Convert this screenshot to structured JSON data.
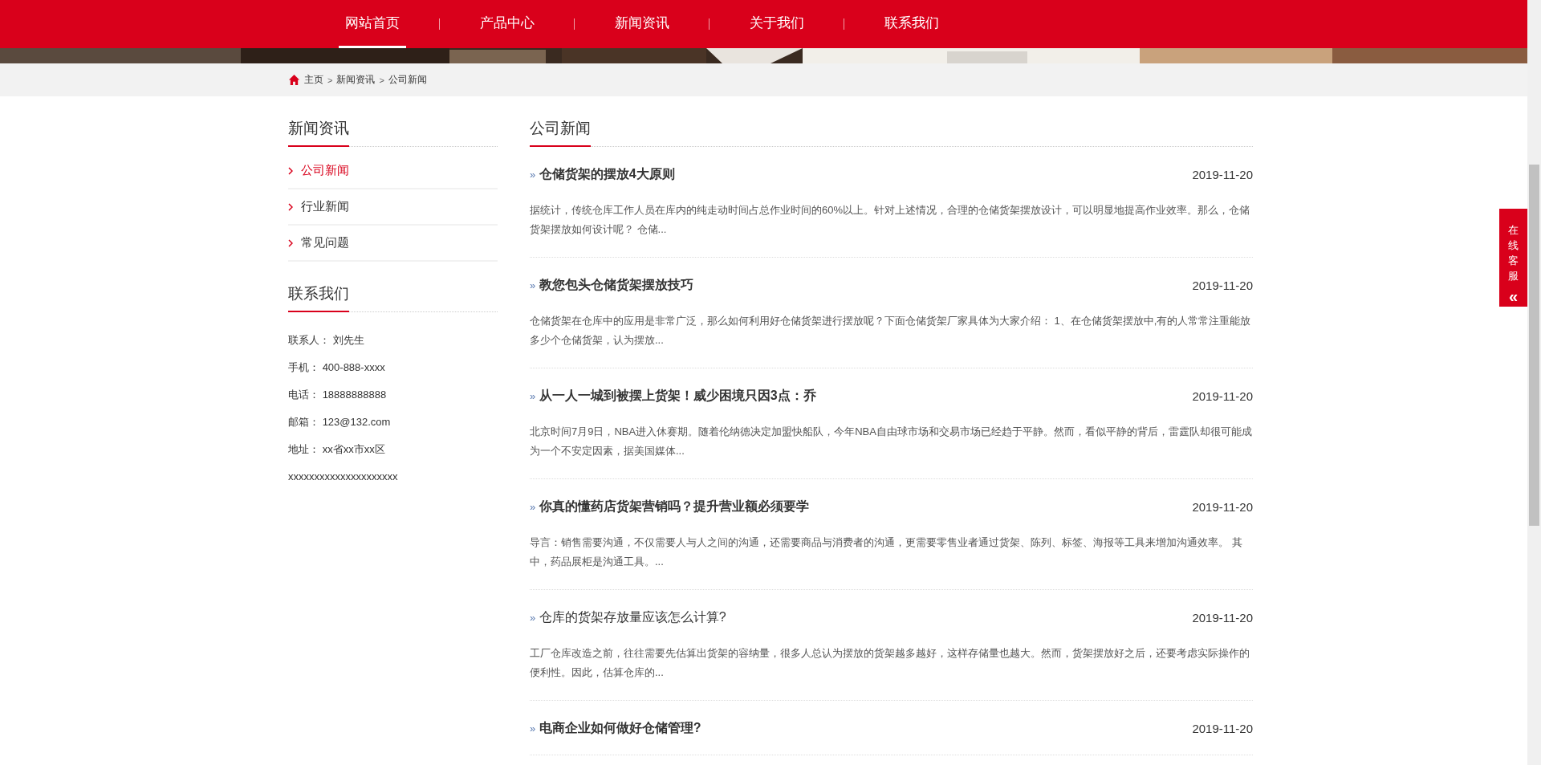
{
  "nav": {
    "items": [
      {
        "label": "网站首页",
        "selected": true
      },
      {
        "label": "产品中心",
        "selected": false
      },
      {
        "label": "新闻资讯",
        "selected": false
      },
      {
        "label": "关于我们",
        "selected": false
      },
      {
        "label": "联系我们",
        "selected": false
      }
    ]
  },
  "breadcrumb": {
    "items": [
      "主页",
      "新闻资讯",
      "公司新闻"
    ],
    "separator": ">"
  },
  "sidebar": {
    "category_title": "新闻资讯",
    "categories": [
      {
        "label": "公司新闻",
        "selected": true
      },
      {
        "label": "行业新闻",
        "selected": false
      },
      {
        "label": "常见问题",
        "selected": false
      }
    ],
    "contact_title": "联系我们",
    "contact_lines": [
      {
        "label": "联系人：",
        "value": "刘先生"
      },
      {
        "label": "手机：",
        "value": "400-888-xxxx"
      },
      {
        "label": "电话：",
        "value": "18888888888"
      },
      {
        "label": "邮箱：",
        "value": "123@132.com"
      },
      {
        "label": "地址：",
        "value": "xx省xx市xx区"
      },
      {
        "value": "xxxxxxxxxxxxxxxxxxxxx"
      }
    ]
  },
  "main": {
    "title": "公司新闻",
    "bullet": "»",
    "articles": [
      {
        "title": "仓储货架的摆放4大原则",
        "bold": true,
        "date": "2019-11-20",
        "summary": "据统计，传统仓库工作人员在库内的纯走动时间占总作业时间的60%以上。针对上述情况，合理的仓储货架摆放设计，可以明显地提高作业效率。那么，仓储货架摆放如何设计呢？ 仓储..."
      },
      {
        "title": "教您包头仓储货架摆放技巧",
        "bold": true,
        "date": "2019-11-20",
        "summary": "仓储货架在仓库中的应用是非常广泛，那么如何利用好仓储货架进行摆放呢？下面仓储货架厂家具体为大家介绍： 1、在仓储货架摆放中,有的人常常注重能放多少个仓储货架，认为摆放..."
      },
      {
        "title": "从一人一城到被摆上货架！威少困境只因3点：乔",
        "bold": true,
        "date": "2019-11-20",
        "summary": "北京时间7月9日，NBA进入休赛期。随着伦纳德决定加盟快船队，今年NBA自由球市场和交易市场已经趋于平静。然而，看似平静的背后，雷霆队却很可能成为一个不安定因素，据美国媒体..."
      },
      {
        "title": "你真的懂药店货架营销吗？提升营业额必须要学",
        "bold": true,
        "date": "2019-11-20",
        "summary": "导言：销售需要沟通，不仅需要人与人之间的沟通，还需要商品与消费者的沟通，更需要零售业者通过货架、陈列、标签、海报等工具来增加沟通效率。 其中，药品展柜是沟通工具。..."
      },
      {
        "title": "仓库的货架存放量应该怎么计算?",
        "bold": false,
        "date": "2019-11-20",
        "summary": "工厂仓库改造之前，往往需要先估算出货架的容纳量，很多人总认为摆放的货架越多越好，这样存储量也越大。然而，货架摆放好之后，还要考虑实际操作的便利性。因此，估算仓库的..."
      },
      {
        "title": "电商企业如何做好仓储管理?",
        "bold": true,
        "date": "2019-11-20"
      }
    ]
  },
  "service_widget": {
    "label": "在线客服",
    "arrow": "«"
  }
}
